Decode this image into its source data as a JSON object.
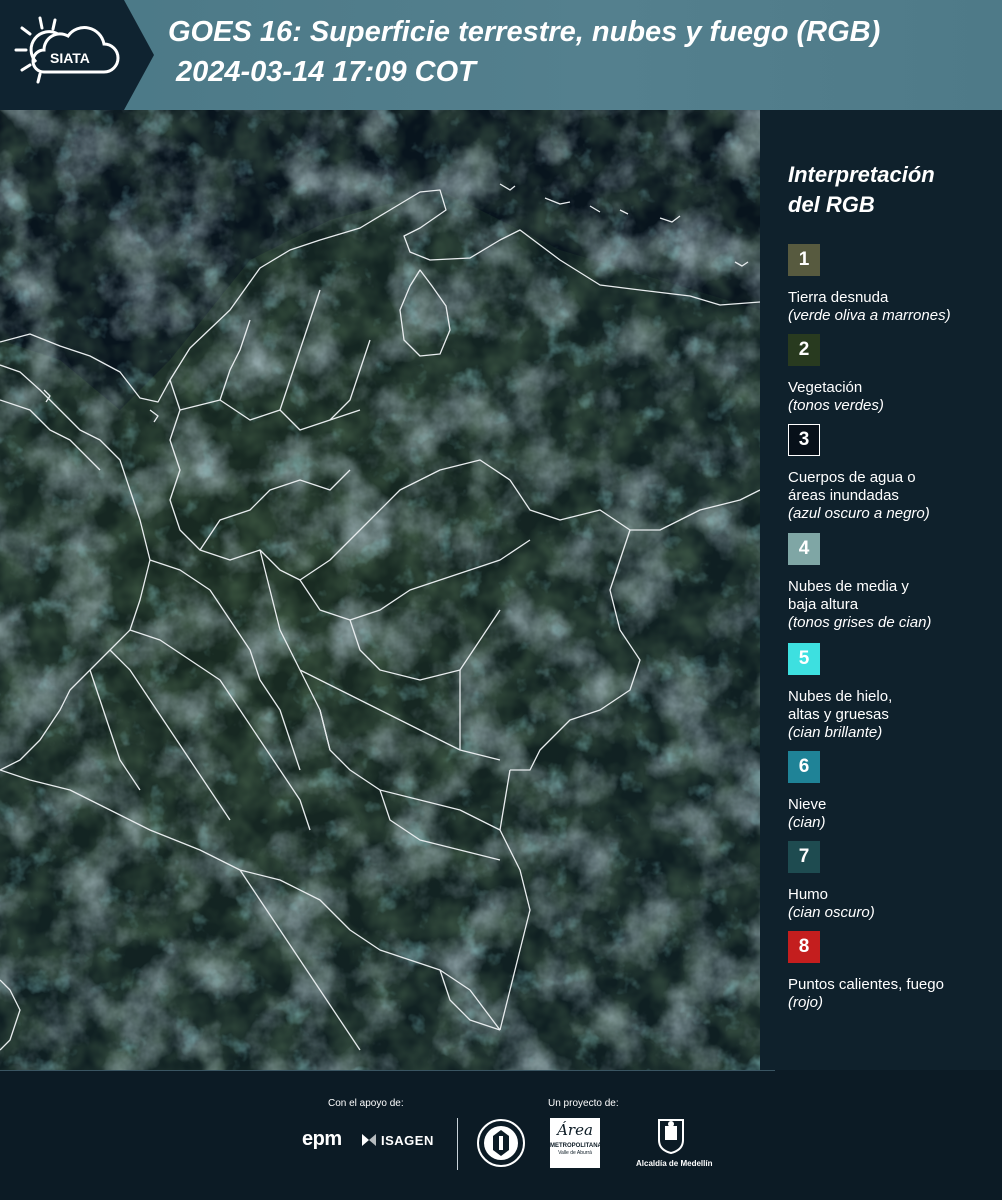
{
  "header": {
    "logo_text": "SIATA",
    "title": "GOES 16: Superficie terrestre, nubes y fuego (RGB)",
    "subtitle": "2024-03-14 17:09 COT"
  },
  "legend": {
    "title_line1": "Interpretación",
    "title_line2": "del RGB",
    "items": [
      {
        "num": "1",
        "color": "#575a3f",
        "lines": [
          "Tierra desnuda"
        ],
        "sub": "(verde oliva a marrones)"
      },
      {
        "num": "2",
        "color": "#283a1f",
        "lines": [
          "Vegetación"
        ],
        "sub": "(tonos verdes)"
      },
      {
        "num": "3",
        "color": "#071019",
        "lines": [
          "Cuerpos de agua o",
          "áreas inundadas"
        ],
        "sub": "(azul oscuro a negro)"
      },
      {
        "num": "4",
        "color": "#7fa6a5",
        "lines": [
          "Nubes de media y",
          "baja altura"
        ],
        "sub": "(tonos grises de cian)"
      },
      {
        "num": "5",
        "color": "#3de0e0",
        "lines": [
          "Nubes de hielo,",
          "altas y gruesas"
        ],
        "sub": "(cian brillante)"
      },
      {
        "num": "6",
        "color": "#1f8397",
        "lines": [
          "Nieve"
        ],
        "sub": "(cian)"
      },
      {
        "num": "7",
        "color": "#1e4b50",
        "lines": [
          "Humo"
        ],
        "sub": "(cian oscuro)"
      },
      {
        "num": "8",
        "color": "#c41e1e",
        "lines": [
          "Puntos calientes, fuego"
        ],
        "sub": "(rojo)"
      }
    ]
  },
  "footer": {
    "support_caption": "Con el apoyo de:",
    "project_caption": "Un proyecto de:",
    "logo_epm": "epm",
    "logo_isagen": "ISAGEN",
    "logo_metropolitana_1": "Área",
    "logo_metropolitana_2": "METROPOLITANA",
    "logo_metropolitana_3": "Valle de Aburrá",
    "logo_alcaldia": "Alcaldía de Medellín"
  },
  "colors": {
    "header_bg": "#4f7b89",
    "legend_bg": "#0f212c",
    "map_bg": "#0b1a22",
    "border_lines": "#e8ecee"
  }
}
